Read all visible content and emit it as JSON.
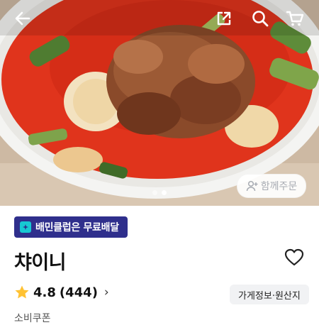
{
  "topbar": {
    "back_icon": "arrow-left-icon",
    "share_icon": "share-external-icon",
    "search_icon": "search-icon",
    "cart_icon": "cart-icon"
  },
  "hero": {
    "image_description_icon": "food-photo",
    "carousel_total": 2,
    "carousel_active": 2,
    "group_order_label": "함께주문"
  },
  "store": {
    "badge_label": "배민클럽은 무료배달",
    "name": "챠이니",
    "rating": "4.8",
    "review_count": "(444)",
    "info_button": "가게정보·원산지",
    "coupon_label": "소비쿠폰"
  },
  "colors": {
    "badge_bg": "#2f2f8c",
    "badge_icon": "#17c9d3",
    "star": "#ffc233",
    "soup": "#e0341c"
  }
}
